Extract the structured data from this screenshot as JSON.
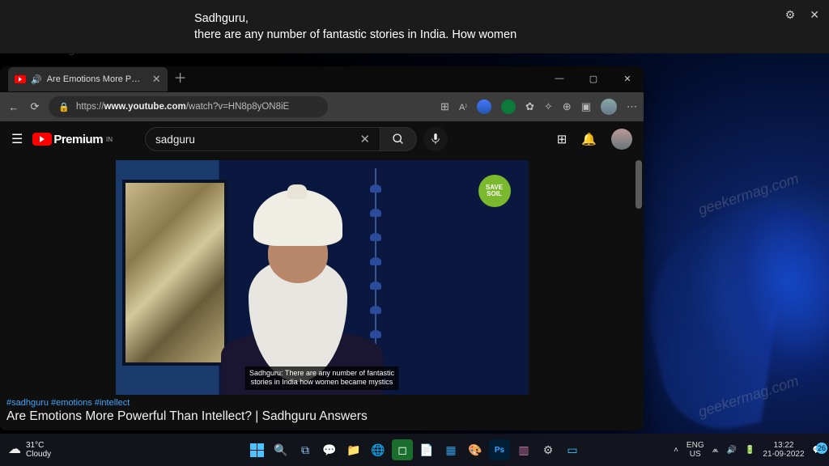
{
  "caption_overlay": {
    "text": "Sadhguru,\nthere are any number of fantastic stories in India. How women"
  },
  "browser": {
    "tab": {
      "title": "Are Emotions More Powerfu"
    },
    "url": {
      "prefix": "https://",
      "host": "www.youtube.com",
      "path": "/watch?v=HN8p8yON8iE"
    }
  },
  "youtube": {
    "brand": "Premium",
    "region": "IN",
    "search_value": "sadguru",
    "video_caption": "Sadhguru: There are any number of fantastic\nstories in India how women became mystics",
    "badge_top": "SAVE",
    "badge_bottom": "SOIL",
    "hashtags": "#sadhguru #emotions #intellect",
    "video_title": "Are Emotions More Powerful Than Intellect? | Sadhguru Answers"
  },
  "taskbar": {
    "weather_temp": "31°C",
    "weather_desc": "Cloudy",
    "lang_top": "ENG",
    "lang_bottom": "US",
    "time": "13:22",
    "date": "21-09-2022",
    "notif_count": "26"
  },
  "watermark": "geekermag.com"
}
